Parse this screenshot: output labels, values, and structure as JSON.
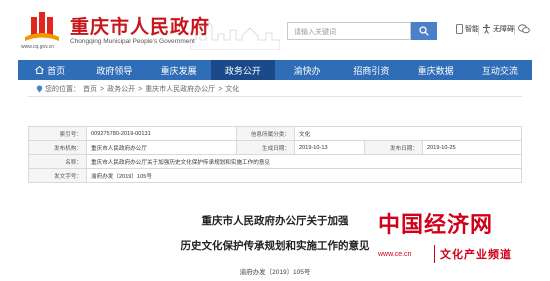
{
  "header": {
    "title": "重庆市人民政府",
    "subtitle": "Chongqing Municipal People's Government",
    "logo_url_text": "www.cq.gov.cn",
    "search_placeholder": "请输入关键词",
    "utilities": [
      {
        "label": "智能",
        "icon": "mobile-icon"
      },
      {
        "label": "无障碍",
        "icon": "accessibility-icon"
      },
      {
        "label": "",
        "icon": "wechat-icon"
      }
    ]
  },
  "nav": {
    "items": [
      {
        "label": "首页",
        "icon": "home-icon"
      },
      {
        "label": "政府领导"
      },
      {
        "label": "重庆发展"
      },
      {
        "label": "政务公开",
        "active": true
      },
      {
        "label": "渝快办"
      },
      {
        "label": "招商引资"
      },
      {
        "label": "重庆数据"
      },
      {
        "label": "互动交流"
      }
    ]
  },
  "breadcrumb": {
    "prefix": "您的位置：",
    "items": [
      "首页",
      "政务公开",
      "重庆市人民政府办公厅",
      "文化"
    ],
    "separator": ">"
  },
  "info": {
    "rows": [
      [
        {
          "k": "索引号：",
          "v": "009275780-2019-00131"
        },
        {
          "k": "信息所属分类：",
          "v": "文化"
        }
      ],
      [
        {
          "k": "发布机构：",
          "v": "重庆市人民政府办公厅"
        },
        {
          "k": "生成日期：",
          "v": "2019-10-13"
        },
        {
          "k": "发布日期：",
          "v": "2019-10-25"
        }
      ],
      [
        {
          "k": "名称：",
          "v": "重庆市人民政府办公厅关于加强历史文化保护传承规划和实施工作的意见"
        }
      ],
      [
        {
          "k": "发文字号：",
          "v": "渝府办发〔2019〕105号"
        }
      ]
    ]
  },
  "document": {
    "title_line1": "重庆市人民政府办公厅关于加强",
    "title_line2": "历史文化保护传承规划和实施工作的意见",
    "doc_number": "渝府办发〔2019〕105号"
  },
  "watermark": {
    "brand": "中国经济网",
    "url": "www.ce.cn",
    "channel": "文化产业频道"
  },
  "colors": {
    "brand_red": "#c8161d",
    "nav_blue": "#2f6db7",
    "nav_active": "#1a4a8a",
    "watermark_red": "#d0021b"
  }
}
